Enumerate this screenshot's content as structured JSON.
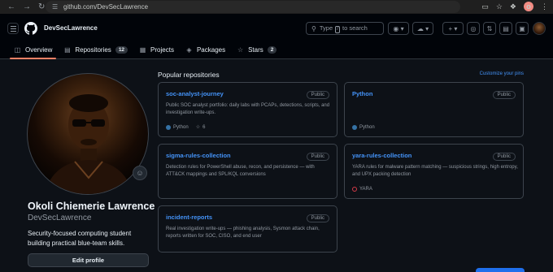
{
  "browser": {
    "url": "github.com/DevSecLawrence",
    "profile_initial": "o"
  },
  "header": {
    "owner": "DevSecLawrence",
    "search": {
      "prefix": "Type",
      "key": "/",
      "suffix": "to search"
    }
  },
  "tabs": [
    {
      "label": "Overview",
      "icon": "book-icon",
      "count": ""
    },
    {
      "label": "Repositories",
      "icon": "repo-icon",
      "count": "12"
    },
    {
      "label": "Projects",
      "icon": "table-icon",
      "count": ""
    },
    {
      "label": "Packages",
      "icon": "package-icon",
      "count": ""
    },
    {
      "label": "Stars",
      "icon": "star-icon",
      "count": "2"
    }
  ],
  "profile": {
    "fullname": "Okoli Chiemerie Lawrence",
    "login": "DevSecLawrence",
    "bio": "Security-focused computing student building practical blue-team skills.",
    "edit_label": "Edit profile"
  },
  "popular": {
    "title": "Popular repositories",
    "customize": "Customize your pins",
    "repos": [
      {
        "name": "soc-analyst-journey",
        "visibility": "Public",
        "description": "Public SOC analyst portfolio: daily labs with PCAPs, detections, scripts, and investigation write-ups.",
        "language": "Python",
        "lang_color": "#3572A5",
        "stars": "6"
      },
      {
        "name": "Python",
        "visibility": "Public",
        "description": "",
        "language": "Python",
        "lang_color": "#3572A5",
        "stars": ""
      },
      {
        "name": "sigma-rules-collection",
        "visibility": "Public",
        "description": "Detection rules for PowerShell abuse, recon, and persistence — with ATT&CK mappings and SPL/KQL conversions",
        "language": "",
        "lang_color": "",
        "stars": ""
      },
      {
        "name": "yara-rules-collection",
        "visibility": "Public",
        "description": "YARA rules for malware pattern matching — suspicious strings, high entropy, and UPX packing detection",
        "language": "YARA",
        "lang_color": "#d73a49",
        "stars": ""
      },
      {
        "name": "incident-reports",
        "visibility": "Public",
        "description": "Real investigation write-ups — phishing analysis, Sysmon attack chain, reports written for SOC, CISO, and end user",
        "language": "",
        "lang_color": "",
        "stars": ""
      }
    ]
  }
}
